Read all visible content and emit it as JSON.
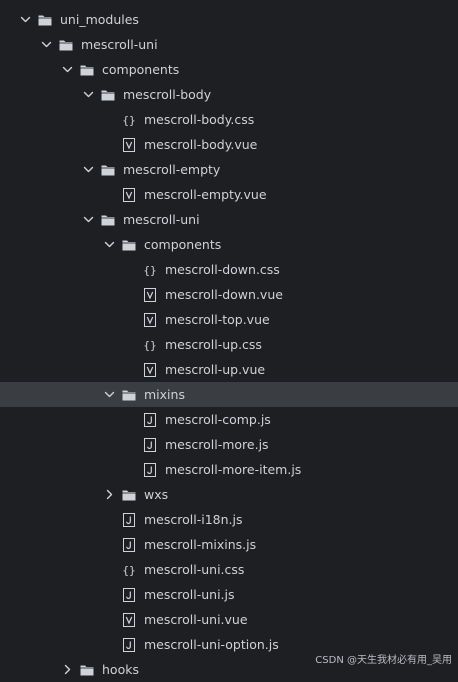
{
  "explorer": {
    "items": [
      {
        "label": "uni_modules",
        "kind": "folder",
        "depth": 0,
        "expanded": true
      },
      {
        "label": "mescroll-uni",
        "kind": "folder",
        "depth": 1,
        "expanded": true
      },
      {
        "label": "components",
        "kind": "folder",
        "depth": 2,
        "expanded": true
      },
      {
        "label": "mescroll-body",
        "kind": "folder",
        "depth": 3,
        "expanded": true
      },
      {
        "label": "mescroll-body.css",
        "kind": "css",
        "depth": 4
      },
      {
        "label": "mescroll-body.vue",
        "kind": "vue",
        "depth": 4
      },
      {
        "label": "mescroll-empty",
        "kind": "folder",
        "depth": 3,
        "expanded": true
      },
      {
        "label": "mescroll-empty.vue",
        "kind": "vue",
        "depth": 4
      },
      {
        "label": "mescroll-uni",
        "kind": "folder",
        "depth": 3,
        "expanded": true
      },
      {
        "label": "components",
        "kind": "folder",
        "depth": 4,
        "expanded": true
      },
      {
        "label": "mescroll-down.css",
        "kind": "css",
        "depth": 5
      },
      {
        "label": "mescroll-down.vue",
        "kind": "vue",
        "depth": 5
      },
      {
        "label": "mescroll-top.vue",
        "kind": "vue",
        "depth": 5
      },
      {
        "label": "mescroll-up.css",
        "kind": "css",
        "depth": 5
      },
      {
        "label": "mescroll-up.vue",
        "kind": "vue",
        "depth": 5
      },
      {
        "label": "mixins",
        "kind": "folder",
        "depth": 4,
        "expanded": true,
        "selected": true
      },
      {
        "label": "mescroll-comp.js",
        "kind": "js",
        "depth": 5
      },
      {
        "label": "mescroll-more.js",
        "kind": "js",
        "depth": 5
      },
      {
        "label": "mescroll-more-item.js",
        "kind": "js",
        "depth": 5
      },
      {
        "label": "wxs",
        "kind": "folder",
        "depth": 4,
        "expanded": false
      },
      {
        "label": "mescroll-i18n.js",
        "kind": "js",
        "depth": 4
      },
      {
        "label": "mescroll-mixins.js",
        "kind": "js",
        "depth": 4
      },
      {
        "label": "mescroll-uni.css",
        "kind": "css",
        "depth": 4
      },
      {
        "label": "mescroll-uni.js",
        "kind": "js",
        "depth": 4
      },
      {
        "label": "mescroll-uni.vue",
        "kind": "vue",
        "depth": 4
      },
      {
        "label": "mescroll-uni-option.js",
        "kind": "js",
        "depth": 4
      },
      {
        "label": "hooks",
        "kind": "folder",
        "depth": 2,
        "expanded": false
      }
    ]
  },
  "watermark": "CSDN @天生我材必有用_吴用",
  "colors": {
    "background": "#1e1f22",
    "selected_row": "#3a3d42",
    "text": "#cfd2d6",
    "icon": "#cfd2d6"
  }
}
